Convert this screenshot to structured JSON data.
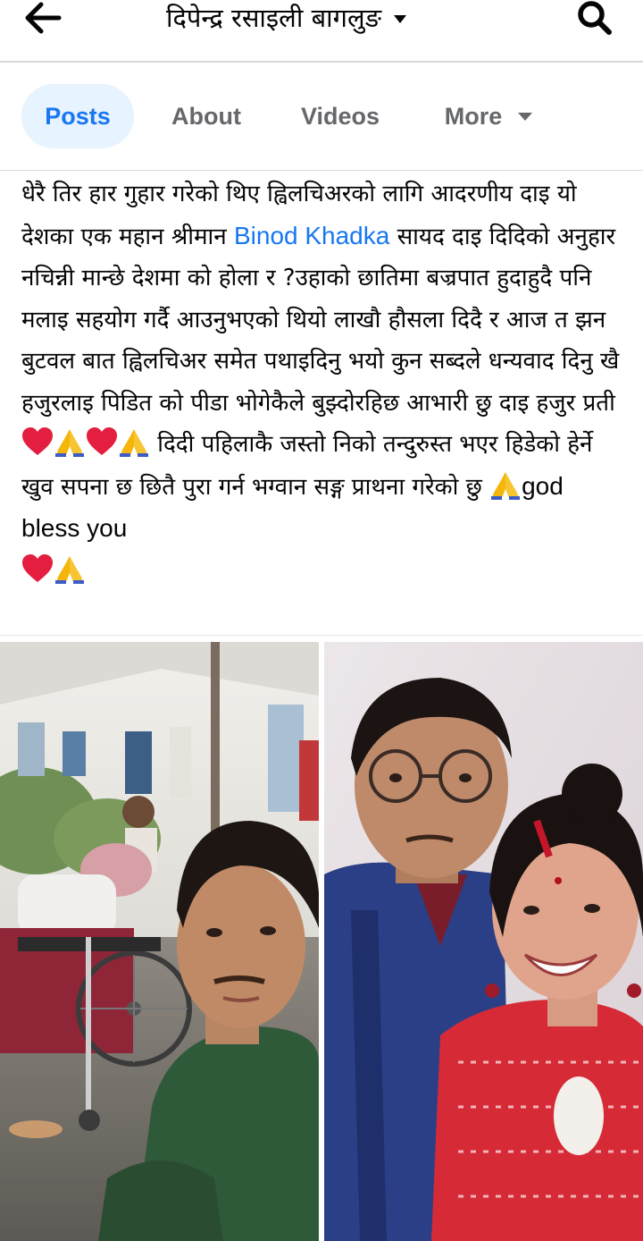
{
  "header": {
    "title": "दिपेन्द्र रसाइली बागलुङ",
    "back_icon": "back-arrow-icon",
    "search_icon": "search-icon"
  },
  "tabs": [
    {
      "label": "Posts",
      "active": true
    },
    {
      "label": "About",
      "active": false
    },
    {
      "label": "Videos",
      "active": false
    },
    {
      "label": "More",
      "active": false
    }
  ],
  "post": {
    "text_part1": "धेरै तिर हार गुहार गरेको थिए ह्विलचिअरको लागि आदरणीय दाइ यो देशका एक महान श्रीमान ",
    "mention": "Binod Khadka",
    "text_part2": " सायद दाइ दिदिको अनुहार नचिन्नी मान्छे देशमा को होला र ?उहाको छातिमा बज्रपात हुदाहुदै पनि मलाइ सहयोग गर्दै आउनुभएको थियो लाखौ हौसला  दिदै र आज त झन बुटवल बात ह्विलचिअर समेत पथाइदिनु भयो कुन सब्दले धन्यवाद दिनु खै हजुरलाइ पिडित को पीडा भोगेकैले बुझ्दोरहिछ आभारी छु दाइ हजुर प्रती ",
    "text_part3": " दिदी पहिलाकै जस्तो निको तन्दुरुस्त भएर हिडेको हेर्ने खुव सपना छ छितै पुरा गर्न भग्वान  सङ्ग प्राथना गरेको छु ",
    "text_part4": "god bless you",
    "emoji_names": [
      "red-heart-icon",
      "folded-hands-icon"
    ]
  },
  "photos": [
    {
      "name": "photo-man-with-wheelchair"
    },
    {
      "name": "photo-couple-portrait"
    }
  ],
  "colors": {
    "accent": "#1877f2",
    "active_tab_bg": "#e7f3ff",
    "muted_text": "#65676b",
    "heart": "#e41e3f",
    "hands": "#f5b50a"
  }
}
